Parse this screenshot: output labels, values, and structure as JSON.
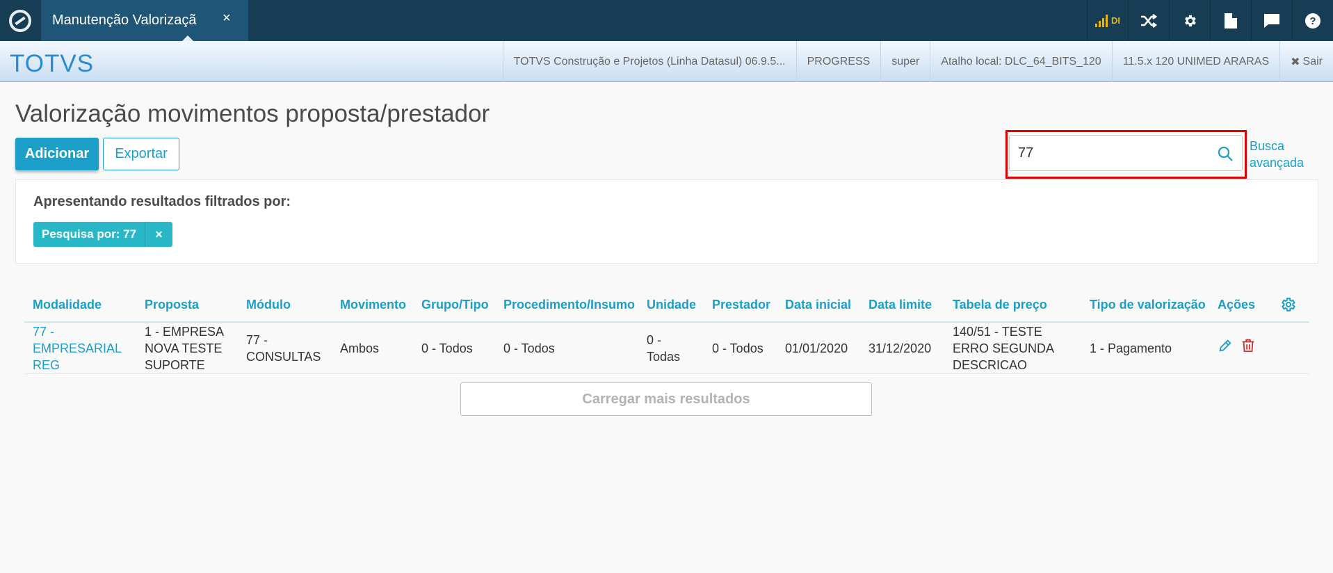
{
  "topbar": {
    "tab_title": "Manutenção Valorizaçã",
    "tab_close": "×",
    "signal_label": "DI"
  },
  "brandbar": {
    "brand": "TOTVS",
    "infos": [
      "TOTVS Construção e Projetos (Linha Datasul) 06.9.5...",
      "PROGRESS",
      "super",
      "Atalho local: DLC_64_BITS_120",
      "11.5.x 120 UNIMED ARARAS"
    ],
    "exit_label": "Sair"
  },
  "page": {
    "title": "Valorização movimentos proposta/prestador",
    "add_button": "Adicionar",
    "export_button": "Exportar",
    "search_value": "77",
    "advanced_search": "Busca avançada"
  },
  "filter": {
    "title": "Apresentando resultados filtrados por:",
    "chip_label": "Pesquisa por: 77",
    "chip_close": "×"
  },
  "table": {
    "headers": [
      "Modalidade",
      "Proposta",
      "Módulo",
      "Movimento",
      "Grupo/Tipo",
      "Procedimento/Insumo",
      "Unidade",
      "Prestador",
      "Data inicial",
      "Data limite",
      "Tabela de preço",
      "Tipo de valorização",
      "Ações"
    ],
    "rows": [
      {
        "modalidade": [
          "77 -",
          "EMPRESARIAL",
          "REG"
        ],
        "proposta": [
          "1 - EMPRESA",
          "NOVA TESTE",
          "SUPORTE"
        ],
        "modulo": [
          "77 -",
          "CONSULTAS"
        ],
        "movimento": "Ambos",
        "grupo_tipo": "0 - Todos",
        "procedimento": "0 - Todos",
        "unidade": [
          "0 -",
          "Todas"
        ],
        "prestador": "0 - Todos",
        "data_inicial": "01/01/2020",
        "data_limite": "31/12/2020",
        "tabela_preco": [
          "140/51 - TESTE",
          "ERRO SEGUNDA",
          "DESCRICAO"
        ],
        "tipo_valorizacao": "1 - Pagamento"
      }
    ],
    "load_more": "Carregar mais resultados"
  },
  "colors": {
    "topbar": "#163d54",
    "accent": "#1b9fc9",
    "chip": "#29b6c6",
    "delete": "#d32f2f",
    "highlight": "#e00000"
  }
}
